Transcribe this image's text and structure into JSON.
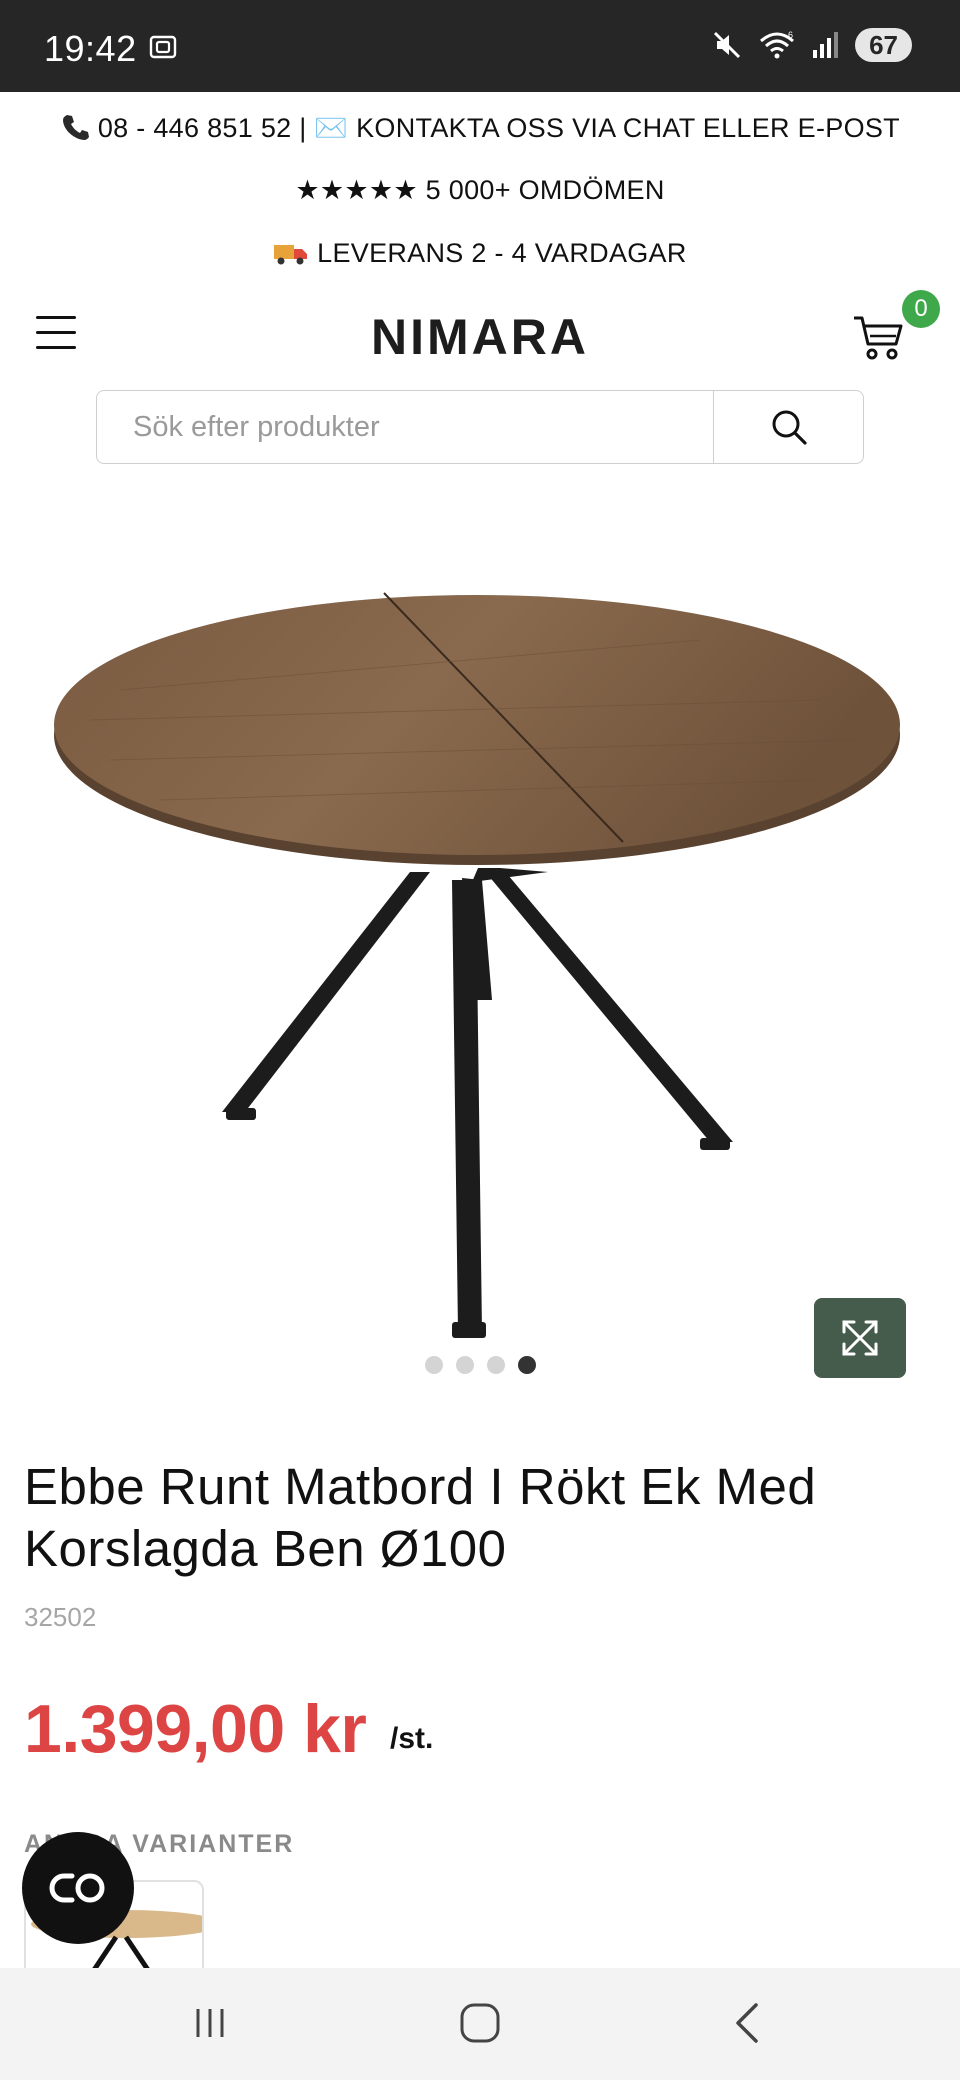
{
  "status_bar": {
    "time": "19:42",
    "battery": "67",
    "icons": [
      "screen-record-icon",
      "mute-icon",
      "wifi-icon",
      "signal-icon"
    ]
  },
  "promo": {
    "contact": "08 - 446 851 52 | ✉️ KONTAKTA OSS VIA CHAT ELLER E-POST",
    "reviews": "★★★★★ 5 000+ OMDÖMEN",
    "delivery": "LEVERANS 2 - 4 VARDAGAR"
  },
  "header": {
    "logo": "NIMARA",
    "cart_count": "0"
  },
  "search": {
    "placeholder": "Sök efter produkter"
  },
  "gallery": {
    "slide_count": 4,
    "active_slide": 4
  },
  "product": {
    "title": "Ebbe Runt Matbord I Rökt Ek Med Korslagda Ben Ø100",
    "sku": "32502",
    "price": "1.399,00 kr",
    "unit": "/st.",
    "variants_label": "ANDRA VARIANTER"
  },
  "colors": {
    "price_red": "#dd4444",
    "badge_green": "#3fa84a",
    "expand_button": "#455b4b",
    "status_bar": "#262626"
  }
}
